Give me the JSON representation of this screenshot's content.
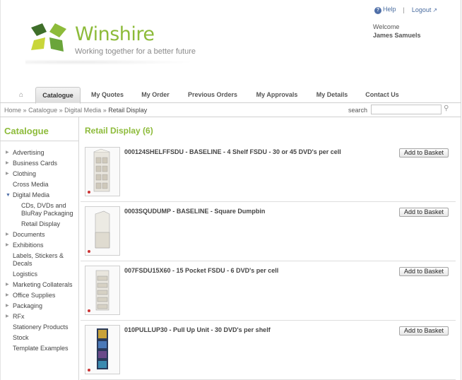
{
  "header": {
    "help_label": "Help",
    "logout_label": "Logout",
    "welcome_label": "Welcome",
    "user_name": "James Samuels",
    "brand_name": "Winshire",
    "tagline": "Working together for a better future",
    "brand_color": "#8dbb3a"
  },
  "nav": {
    "tabs": [
      {
        "label": "Catalogue",
        "active": true
      },
      {
        "label": "My Quotes"
      },
      {
        "label": "My Order"
      },
      {
        "label": "Previous Orders"
      },
      {
        "label": "My Approvals"
      },
      {
        "label": "My Details"
      },
      {
        "label": "Contact Us"
      }
    ]
  },
  "breadcrumb": {
    "home": "Home",
    "sep": "»",
    "level1": "Catalogue",
    "level2": "Digital Media",
    "current": "Retail Display"
  },
  "search": {
    "label": "search",
    "value": ""
  },
  "sidebar": {
    "title": "Catalogue",
    "items": [
      {
        "label": "Advertising",
        "arrow": "closed"
      },
      {
        "label": "Business Cards",
        "arrow": "closed"
      },
      {
        "label": "Clothing",
        "arrow": "closed"
      },
      {
        "label": "Cross Media",
        "arrow": "none"
      },
      {
        "label": "Digital Media",
        "arrow": "open"
      },
      {
        "label": "CDs, DVDs and BluRay Packaging",
        "arrow": "none",
        "sub": true
      },
      {
        "label": "Retail Display",
        "arrow": "none",
        "sub": true
      },
      {
        "label": "Documents",
        "arrow": "closed"
      },
      {
        "label": "Exhibitions",
        "arrow": "closed"
      },
      {
        "label": "Labels, Stickers & Decals",
        "arrow": "none"
      },
      {
        "label": "Logistics",
        "arrow": "none"
      },
      {
        "label": "Marketing Collaterals",
        "arrow": "closed"
      },
      {
        "label": "Office Supplies",
        "arrow": "closed"
      },
      {
        "label": "Packaging",
        "arrow": "closed"
      },
      {
        "label": "RFx",
        "arrow": "closed"
      },
      {
        "label": "Stationery Products",
        "arrow": "none"
      },
      {
        "label": "Stock",
        "arrow": "none"
      },
      {
        "label": "Template Examples",
        "arrow": "none"
      }
    ]
  },
  "main": {
    "title": "Retail Display (6)",
    "basket_label": "Add to Basket",
    "products": [
      {
        "title": "000124SHELFFSDU - BASELINE - 4 Shelf FSDU - 30 or 45 DVD's per cell",
        "thumb": "shelf-fsdu"
      },
      {
        "title": "0003SQUDUMP - BASELINE - Square Dumpbin",
        "thumb": "dumpbin"
      },
      {
        "title": "007FSDU15X60 - 15 Pocket FSDU - 6 DVD's per cell",
        "thumb": "pocket-fsdu"
      },
      {
        "title": "010PULLUP30 - Pull Up Unit - 30 DVD's per shelf",
        "thumb": "pullup"
      }
    ]
  }
}
